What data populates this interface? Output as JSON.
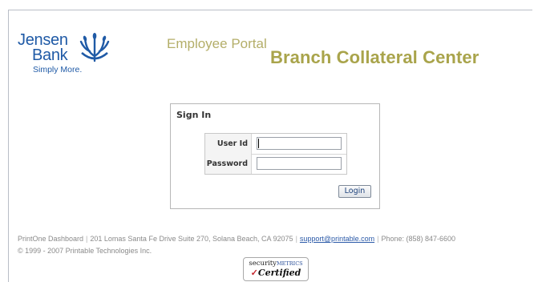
{
  "brand": {
    "name_line1": "Jensen",
    "name_line2": "Bank",
    "tagline": "Simply More.",
    "color": "#1f5aa6",
    "icon": "wheat-icon"
  },
  "header": {
    "portal_label": "Employee Portal",
    "title": "Branch Collateral Center",
    "title_color": "#a9a44b"
  },
  "signin": {
    "title": "Sign In",
    "user_id_label": "User Id",
    "user_id_value": "",
    "password_label": "Password",
    "password_value": "",
    "login_button": "Login"
  },
  "footer": {
    "product": "PrintOne Dashboard",
    "address": "201 Lomas Santa Fe Drive Suite 270, Solana Beach, CA  92075",
    "support_email": "support@printable.com",
    "phone": "Phone: (858) 847-6600",
    "copyright": "© 1999 - 2007 Printable Technologies Inc."
  },
  "badge": {
    "security": "security",
    "metrics": "METRICS",
    "certified": "Certified",
    "check": "✓"
  }
}
